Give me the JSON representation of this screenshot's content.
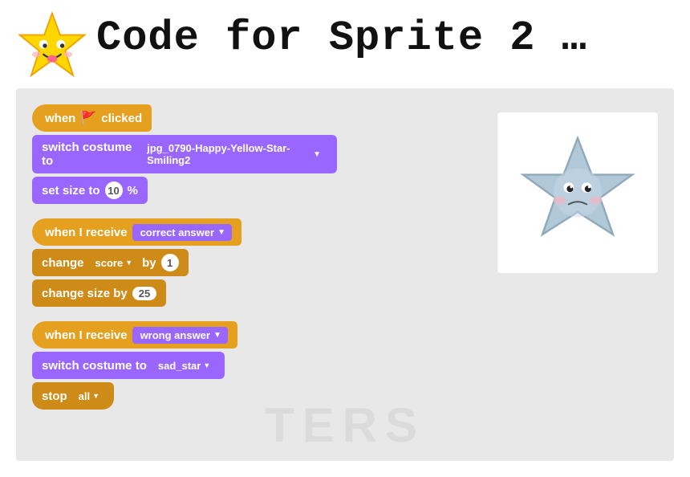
{
  "page": {
    "title": "Code for Sprite 2 …",
    "background": "#ffffff"
  },
  "header": {
    "title_text": "Code for Sprite 2 …",
    "star_emoji": "⭐"
  },
  "blocks": {
    "group1": {
      "block1": {
        "label": "when",
        "flag": "🚩",
        "clicked": "clicked"
      },
      "block2": {
        "label": "switch costume to",
        "value": "jpg_0790-Happy-Yellow-Star-Smiling2"
      },
      "block3": {
        "label": "set size to",
        "number": "10",
        "percent": "%"
      }
    },
    "group2": {
      "block1": {
        "label": "when I receive",
        "value": "correct answer"
      },
      "block2": {
        "label": "change",
        "variable": "score",
        "by": "by",
        "number": "1"
      },
      "block3": {
        "label": "change size by",
        "number": "25"
      }
    },
    "group3": {
      "block1": {
        "label": "when I receive",
        "value": "wrong answer"
      },
      "block2": {
        "label": "switch costume to",
        "value": "sad_star"
      },
      "block3": {
        "label": "stop",
        "value": "all"
      }
    }
  },
  "watermark": "TERS",
  "sprite": {
    "alt": "Sad blue star sprite"
  }
}
